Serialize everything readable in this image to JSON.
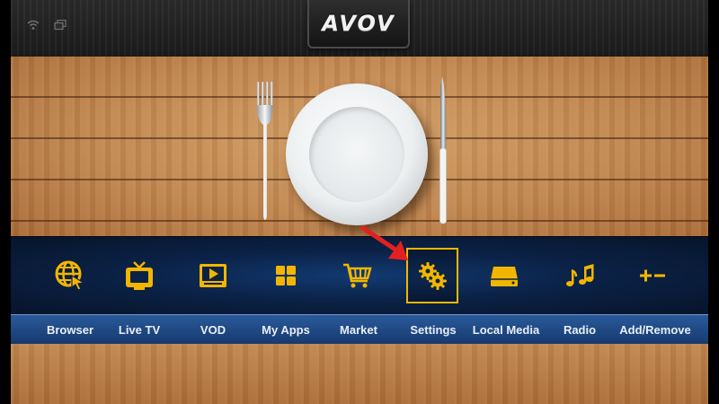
{
  "app": {
    "logo_text": "AVOV"
  },
  "status_bar": {
    "icons": [
      "wifi-icon",
      "network-icon"
    ]
  },
  "menu": {
    "selected_index": 5,
    "accent_color": "#f2b600",
    "items": [
      {
        "label": "Browser",
        "icon": "globe-cursor-icon"
      },
      {
        "label": "Live TV",
        "icon": "tv-icon"
      },
      {
        "label": "VOD",
        "icon": "video-play-icon"
      },
      {
        "label": "My Apps",
        "icon": "apps-grid-icon"
      },
      {
        "label": "Market",
        "icon": "shopping-cart-icon"
      },
      {
        "label": "Settings",
        "icon": "gears-icon"
      },
      {
        "label": "Local Media",
        "icon": "hard-drive-icon"
      },
      {
        "label": "Radio",
        "icon": "music-note-icon"
      },
      {
        "label": "Add/Remove",
        "icon": "plus-minus-icon"
      }
    ]
  },
  "annotation": {
    "icon": "red-arrow-icon",
    "color": "#e32020"
  }
}
